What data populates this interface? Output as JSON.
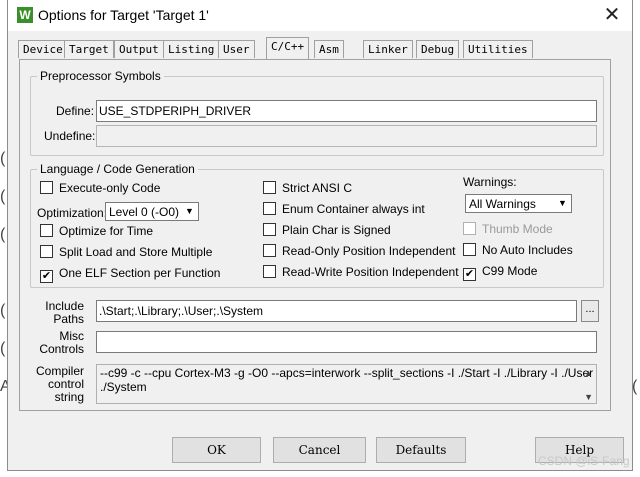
{
  "window": {
    "title": "Options for Target 'Target 1'",
    "app_icon_text": "W"
  },
  "background_glyphs": [
    "(",
    "(",
    "(",
    "(",
    "(",
    "A",
    "("
  ],
  "tabs": [
    "Device",
    "Target",
    "Output",
    "Listing",
    "User",
    "C/C++",
    "Asm",
    "Linker",
    "Debug",
    "Utilities"
  ],
  "active_tab": "C/C++",
  "preprocessor": {
    "legend": "Preprocessor Symbols",
    "define_label": "Define:",
    "define_value": "USE_STDPERIPH_DRIVER",
    "undefine_label": "Undefine:",
    "undefine_value": ""
  },
  "language": {
    "legend": "Language / Code Generation",
    "execute_only": {
      "label": "Execute-only Code",
      "checked": false
    },
    "optimization_label": "Optimization:",
    "optimization_value": "Level 0 (-O0)",
    "optimize_time": {
      "label": "Optimize for Time",
      "checked": false
    },
    "split_load": {
      "label": "Split Load and Store Multiple",
      "checked": false
    },
    "one_elf": {
      "label": "One ELF Section per Function",
      "checked": true
    },
    "strict_ansi": {
      "label": "Strict ANSI C",
      "checked": false
    },
    "enum_container": {
      "label": "Enum Container always int",
      "checked": false
    },
    "plain_char": {
      "label": "Plain Char is Signed",
      "checked": false
    },
    "ro_pi": {
      "label": "Read-Only Position Independent",
      "checked": false
    },
    "rw_pi": {
      "label": "Read-Write Position Independent",
      "checked": false
    },
    "warnings_label": "Warnings:",
    "warnings_value": "All Warnings",
    "thumb_mode": {
      "label": "Thumb Mode",
      "checked": false
    },
    "no_auto_includes": {
      "label": "No Auto Includes",
      "checked": false
    },
    "c99_mode": {
      "label": "C99 Mode",
      "checked": true
    }
  },
  "include": {
    "label_line1": "Include",
    "label_line2": "Paths",
    "value": ".\\Start;.\\Library;.\\User;.\\System",
    "browse_label": "..."
  },
  "misc": {
    "label_line1": "Misc",
    "label_line2": "Controls",
    "value": ""
  },
  "compiler": {
    "label_line1": "Compiler",
    "label_line2": "control",
    "label_line3": "string",
    "line1": "--c99 -c --cpu Cortex-M3 -g -O0 --apcs=interwork --split_sections -I ./Start -I ./Library -I ./User -I",
    "line2": "./System"
  },
  "buttons": {
    "ok": "OK",
    "cancel": "Cancel",
    "defaults": "Defaults",
    "help": "Help"
  },
  "watermark": "CSDN @iS-Fang"
}
